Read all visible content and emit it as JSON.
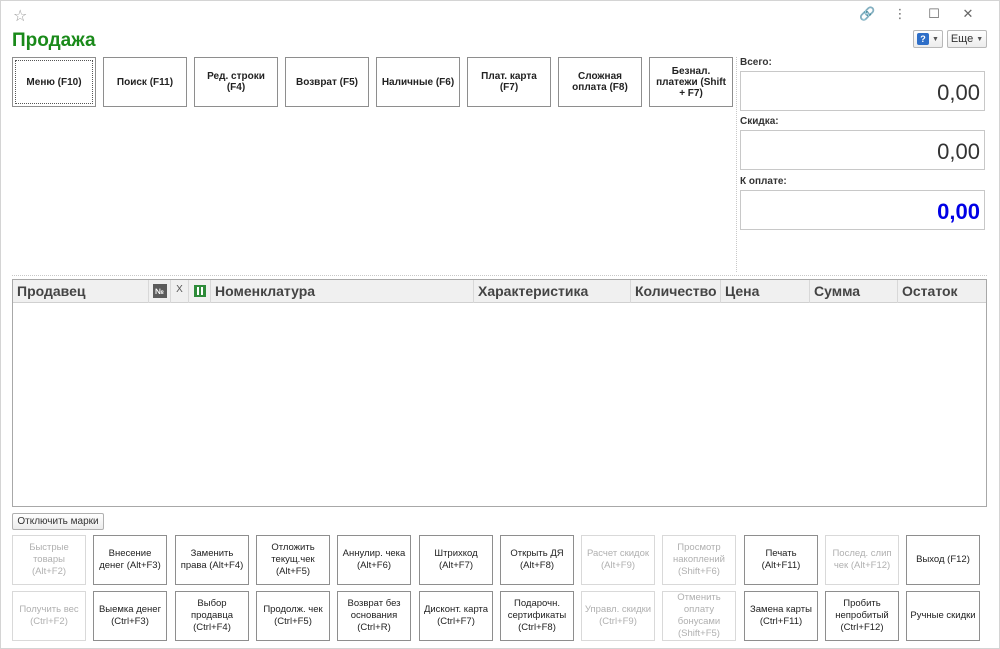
{
  "window": {
    "title": "Продажа",
    "help_label": "?",
    "more_label": "Еще"
  },
  "top_buttons": [
    {
      "label": "Меню (F10)"
    },
    {
      "label": "Поиск (F11)"
    },
    {
      "label": "Ред. строки (F4)"
    },
    {
      "label": "Возврат (F5)"
    },
    {
      "label": "Наличные (F6)"
    },
    {
      "label": "Плат. карта (F7)"
    },
    {
      "label": "Сложная оплата (F8)"
    },
    {
      "label": "Безнал. платежи (Shift + F7)"
    }
  ],
  "totals": {
    "total_label": "Всего:",
    "total_value": "0,00",
    "discount_label": "Скидка:",
    "discount_value": "0,00",
    "to_pay_label": "К оплате:",
    "to_pay_value": "0,00"
  },
  "table": {
    "columns": {
      "seller": "Продавец",
      "no": "№",
      "x": "X",
      "item": "Номенклатура",
      "characteristic": "Характеристика",
      "quantity": "Количество",
      "price": "Цена",
      "sum": "Сумма",
      "remainder": "Остаток"
    }
  },
  "toggle_marks_label": "Отключить марки",
  "function_buttons": {
    "row1": [
      {
        "label": "Быстрые товары (Alt+F2)",
        "enabled": false
      },
      {
        "label": "Внесение денег (Alt+F3)",
        "enabled": true
      },
      {
        "label": "Заменить права (Alt+F4)",
        "enabled": true
      },
      {
        "label": "Отложить текущ.чек (Alt+F5)",
        "enabled": true
      },
      {
        "label": "Аннулир. чека (Alt+F6)",
        "enabled": true
      },
      {
        "label": "Штрихкод (Alt+F7)",
        "enabled": true
      },
      {
        "label": "Открыть ДЯ (Alt+F8)",
        "enabled": true
      },
      {
        "label": "Расчет скидок (Alt+F9)",
        "enabled": false
      },
      {
        "label": "Просмотр накоплений (Shift+F6)",
        "enabled": false
      },
      {
        "label": "Печать (Alt+F11)",
        "enabled": true
      },
      {
        "label": "Послед. слип чек (Alt+F12)",
        "enabled": false
      },
      {
        "label": "Выход (F12)",
        "enabled": true
      }
    ],
    "row2": [
      {
        "label": "Получить вес (Ctrl+F2)",
        "enabled": false
      },
      {
        "label": "Выемка денег (Ctrl+F3)",
        "enabled": true
      },
      {
        "label": "Выбор продавца (Ctrl+F4)",
        "enabled": true
      },
      {
        "label": "Продолж. чек (Ctrl+F5)",
        "enabled": true
      },
      {
        "label": "Возврат без основания (Ctrl+R)",
        "enabled": true
      },
      {
        "label": "Дисконт. карта (Ctrl+F7)",
        "enabled": true
      },
      {
        "label": "Подарочн. сертификаты (Ctrl+F8)",
        "enabled": true
      },
      {
        "label": "Управл. скидки (Ctrl+F9)",
        "enabled": false
      },
      {
        "label": "Отменить оплату бонусами (Shift+F5)",
        "enabled": false
      },
      {
        "label": "Замена карты (Ctrl+F11)",
        "enabled": true
      },
      {
        "label": "Пробить непробитый (Ctrl+F12)",
        "enabled": true
      },
      {
        "label": "Ручные скидки",
        "enabled": true
      }
    ]
  }
}
